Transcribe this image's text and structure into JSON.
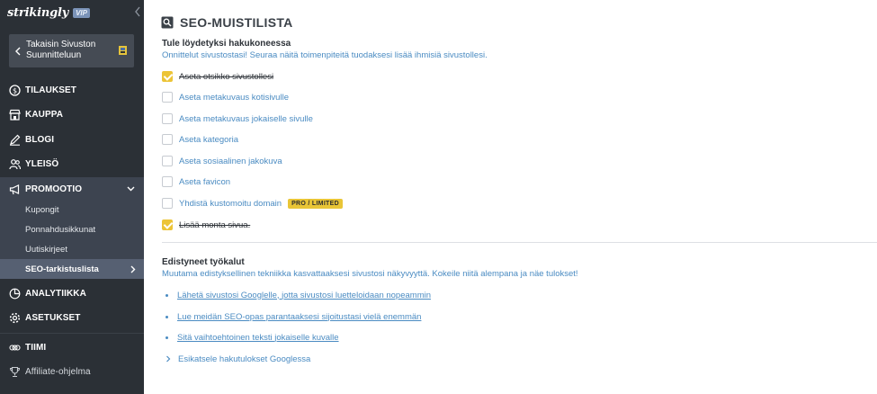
{
  "sidebar": {
    "brand": "strikingly",
    "vip_badge": "VIP",
    "back_label": "Takaisin Sivuston Suunnitteluun",
    "nav": {
      "orders": "TILAUKSET",
      "store": "KAUPPA",
      "blog": "BLOGI",
      "audience": "YLEISÖ",
      "promotion": "PROMOOTIO",
      "analytics": "ANALYTIIKKA",
      "settings": "ASETUKSET",
      "team": "TIIMI",
      "affiliate": "Affiliate-ohjelma"
    },
    "promotion_sub": {
      "coupons": "Kupongit",
      "popups": "Ponnahdusikkunat",
      "newsletters": "Uutiskirjeet",
      "seo_checklist": "SEO-tarkistuslista"
    }
  },
  "main": {
    "title": "SEO-MUISTILISTA",
    "section1": {
      "heading": "Tule löydetyksi hakukoneessa",
      "subtitle": "Onnittelut sivustostasi! Seuraa näitä toimenpiteitä tuodaksesi lisää ihmisiä sivustollesi.",
      "items": [
        {
          "label": "Aseta otsikko sivustollesi",
          "checked": true
        },
        {
          "label": "Aseta metakuvaus kotisivulle",
          "checked": false
        },
        {
          "label": "Aseta metakuvaus jokaiselle sivulle",
          "checked": false
        },
        {
          "label": "Aseta kategoria",
          "checked": false
        },
        {
          "label": "Aseta sosiaalinen jakokuva",
          "checked": false
        },
        {
          "label": "Aseta favicon",
          "checked": false
        },
        {
          "label": "Yhdistä kustomoitu domain",
          "checked": false,
          "badge": "PRO / LIMITED"
        },
        {
          "label": "Lisää monta sivua.",
          "checked": true
        }
      ]
    },
    "section2": {
      "heading": "Edistyneet työkalut",
      "subtitle": "Muutama edistyksellinen tekniikka kasvattaaksesi sivustosi näkyvyyttä. Kokeile niitä alempana ja näe tulokset!",
      "links": [
        "Lähetä sivustosi Googlelle, jotta sivustosi luetteloidaan nopeammin",
        "Lue meidän SEO-opas parantaaksesi sijoitustasi vielä enemmän",
        "Sitä vaihtoehtoinen teksti jokaiselle kuvalle"
      ],
      "preview": "Esikatsele hakutulokset Googlessa"
    }
  },
  "colors": {
    "sidebar_bg": "#2b3036",
    "sidebar_active": "#3d4450",
    "accent_yellow": "#ecc437",
    "link_blue": "#4a8bc2"
  }
}
